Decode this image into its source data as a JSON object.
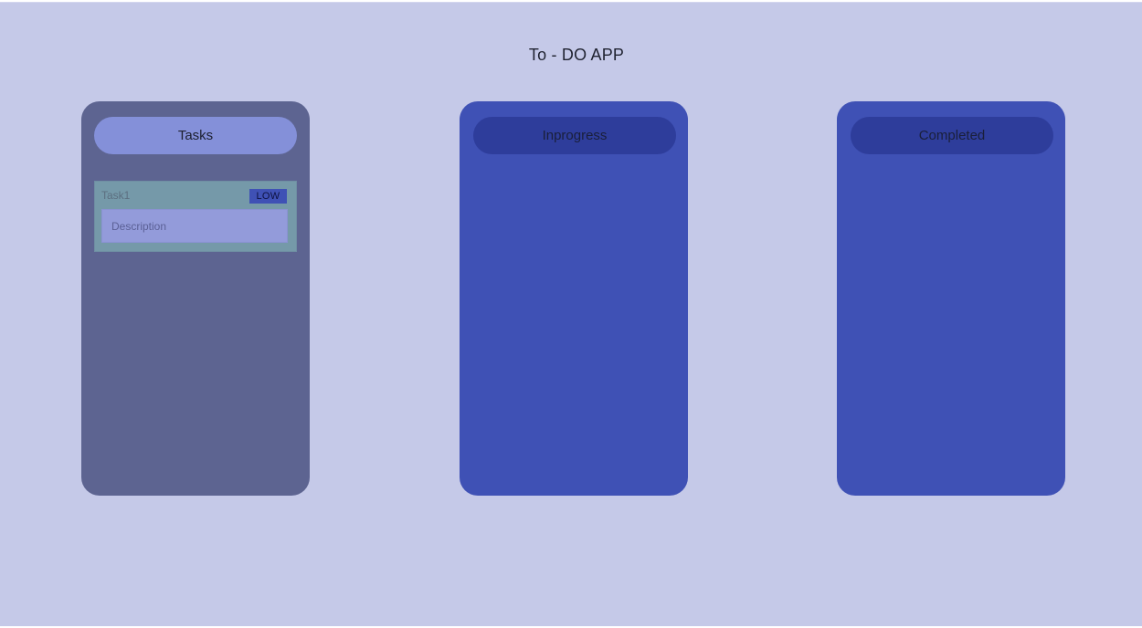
{
  "app": {
    "title": "To - DO APP"
  },
  "columns": [
    {
      "id": "tasks",
      "label": "Tasks",
      "cards": [
        {
          "name": "Task1",
          "priority": "LOW",
          "description_placeholder": "Description",
          "description_value": ""
        }
      ]
    },
    {
      "id": "inprogress",
      "label": "Inprogress",
      "cards": []
    },
    {
      "id": "completed",
      "label": "Completed",
      "cards": []
    }
  ],
  "colors": {
    "background": "#c5c9e8",
    "tasks_column": "#5d6491",
    "active_column": "#3f51b5",
    "tasks_header": "#8490d9",
    "column_header": "#2e3d9b",
    "task_card": "#7599a9",
    "priority_badge": "#3f51b5",
    "description_field": "#939bda"
  }
}
